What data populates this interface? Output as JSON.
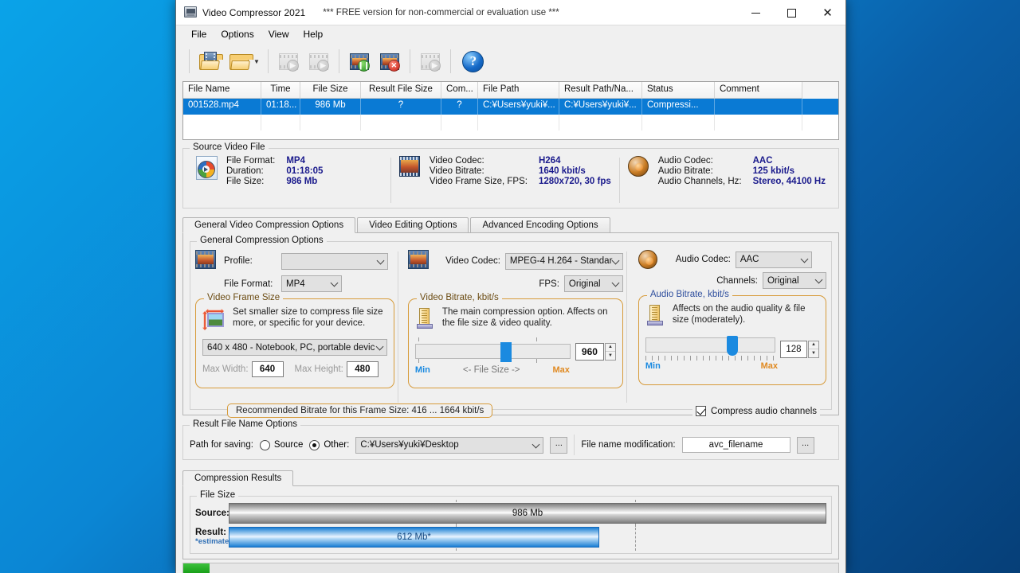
{
  "window": {
    "title": "Video Compressor 2021",
    "free_notice": "*** FREE version for non-commercial or evaluation use ***",
    "minimize": "–",
    "maximize": "☐",
    "close": "✕"
  },
  "menu": [
    "File",
    "Options",
    "View",
    "Help"
  ],
  "toolbar": {
    "add_files": "add-files",
    "add_folder": "add-folder",
    "dropdown_arrow": "▼",
    "start": "start-compression",
    "start_one": "start-selected",
    "pause": "pause-compression",
    "stop": "stop-compression",
    "preview": "preview",
    "help": "?"
  },
  "filelist": {
    "columns": [
      "File Name",
      "Time",
      "File Size",
      "Result File Size",
      "Com...",
      "File Path",
      "Result Path/Na...",
      "Status",
      "Comment"
    ],
    "rows": [
      {
        "name": "001528.mp4",
        "time": "01:18...",
        "size": "986 Mb",
        "result_size": "?",
        "com": "?",
        "path": "C:¥Users¥yuki¥...",
        "result_path": "C:¥Users¥yuki¥...",
        "status": "Compressi...",
        "comment": ""
      }
    ]
  },
  "source_panel": {
    "title": "Source Video File",
    "file": {
      "k1": "File Format:",
      "v1": "MP4",
      "k2": "Duration:",
      "v2": "01:18:05",
      "k3": "File Size:",
      "v3": "986 Mb"
    },
    "video": {
      "k1": "Video Codec:",
      "v1": "H264",
      "k2": "Video Bitrate:",
      "v2": "1640 kbit/s",
      "k3": "Video Frame Size, FPS:",
      "v3": "1280x720, 30 fps"
    },
    "audio": {
      "k1": "Audio Codec:",
      "v1": "AAC",
      "k2": "Audio Bitrate:",
      "v2": "125 kbit/s",
      "k3": "Audio Channels, Hz:",
      "v3": "Stereo, 44100 Hz"
    }
  },
  "tabs": [
    {
      "label": "General Video Compression Options",
      "active": true
    },
    {
      "label": "Video Editing Options",
      "active": false
    },
    {
      "label": "Advanced Encoding Options",
      "active": false
    }
  ],
  "general_options": {
    "groupbox_title": "General Compression Options",
    "profile_label": "Profile:",
    "profile_value": "",
    "file_format_label": "File Format:",
    "file_format_value": "MP4",
    "frame_size": {
      "title": "Video Frame Size",
      "hint_line1": "Set smaller size to compress file size",
      "hint_line2": "more, or specific for your device.",
      "preset": "640 x 480 - Notebook, PC, portable devic",
      "max_width_label": "Max Width:",
      "max_width_value": "640",
      "max_height_label": "Max Height:",
      "max_height_value": "480"
    },
    "video_codec_label": "Video Codec:",
    "video_codec_value": "MPEG-4 H.264 - Standar",
    "fps_label": "FPS:",
    "fps_value": "Original",
    "video_bitrate": {
      "title": "Video Bitrate, kbit/s",
      "hint_line1": "The main compression option. Affects on",
      "hint_line2": "the file size & video quality.",
      "min_label": "Min",
      "max_label": "Max",
      "mid_label": "<-  File Size  ->",
      "value": "960",
      "slider_percent": 55
    },
    "recommended": "Recommended Bitrate for this Frame Size: 416 ... 1664 kbit/s",
    "audio_codec_label": "Audio Codec:",
    "audio_codec_value": "AAC",
    "channels_label": "Channels:",
    "channels_value": "Original",
    "audio_bitrate": {
      "title": "Audio Bitrate, kbit/s",
      "hint_line1": "Affects on the audio quality & file",
      "hint_line2": "size (moderately).",
      "min_label": "Min",
      "max_label": "Max",
      "value": "128",
      "slider_percent": 63
    },
    "compress_audio_channels": "Compress audio channels"
  },
  "result_options": {
    "title": "Result File Name Options",
    "path_label": "Path for saving:",
    "radio_source": "Source",
    "radio_other": "Other:",
    "selected": "other",
    "path_value": "C:¥Users¥yuki¥Desktop",
    "browse": "...",
    "filename_mod_label": "File name modification:",
    "filename_mod_value": "avc_filename",
    "filename_browse": "..."
  },
  "results": {
    "tab_label": "Compression Results",
    "groupbox_title": "File Size",
    "source_label": "Source:",
    "source_value": "986 Mb",
    "source_percent": 100,
    "result_label": "Result:",
    "result_estimated": "*estimated",
    "result_value": "612 Mb*",
    "result_percent": 62
  },
  "status": {
    "progress_percent": 4
  },
  "colors": {
    "selection_blue": "#0a7ad4",
    "accent_orange": "#e08a22",
    "value_blue": "#1a1a8c",
    "progress_green": "#19a019"
  }
}
